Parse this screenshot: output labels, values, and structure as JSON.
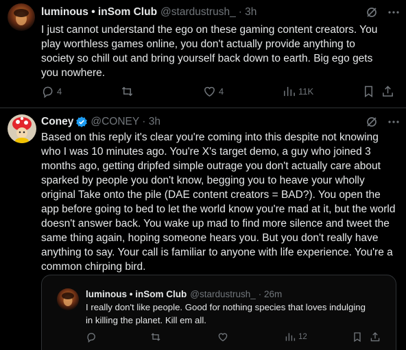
{
  "tweet1": {
    "display_name": "luminous • inSom Club",
    "handle": "@stardustrush_",
    "time": "· 3h",
    "text": "I just cannot understand the ego on these gaming content creators. You play worthless games online, you don't actually provide anything to society so chill out and bring yourself back down to earth. Big ego gets you nowhere.",
    "replies": "4",
    "likes": "4",
    "views": "11K"
  },
  "tweet2": {
    "display_name": "Coney",
    "handle": "@CONEY",
    "time": "· 3h",
    "text": "Based on this reply it's clear you're coming into this despite not knowing who I was 10 minutes ago. You're X's target demo, a guy who joined 3 months ago, getting dripfed simple outrage you don't actually care about sparked by people you don't know, begging you to heave your wholly original Take onto the pile (DAE content creators = BAD?). You open the app before going to bed to let the world know you're mad at it, but the world doesn't answer back. You wake up mad to find more silence and tweet the same thing again, hoping someone hears you. But you don't really have anything to say. Your call is familiar to anyone with life experience. You're a common chirping bird."
  },
  "quote": {
    "display_name": "luminous • inSom Club",
    "handle": "@stardustrush_",
    "time": "· 26m",
    "text": "I really don't like people. Good for nothing species that loves indulging in killing the planet. Kill em all.",
    "views": "12"
  },
  "colors": {
    "background": "#000000",
    "text": "#e7e9ea",
    "secondary": "#71767b",
    "verified": "#1d9bf0",
    "border": "#2f3336"
  }
}
